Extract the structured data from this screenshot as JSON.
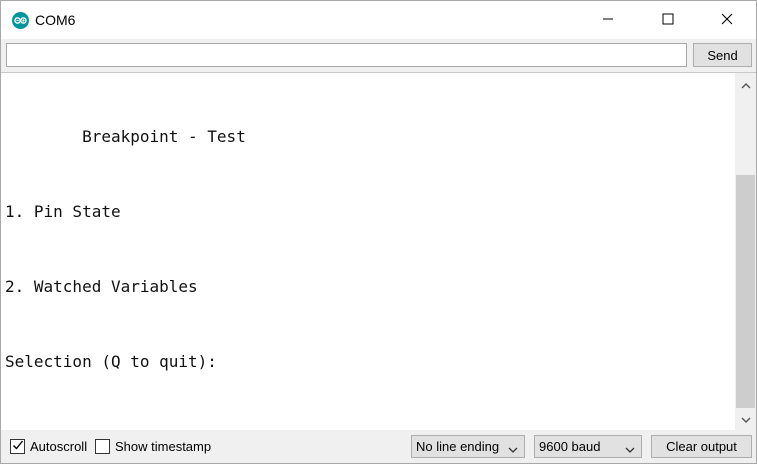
{
  "window": {
    "title": "COM6",
    "icon": "arduino-icon",
    "controls": [
      "minimize-icon",
      "maximize-icon",
      "close-icon"
    ]
  },
  "input": {
    "value": "",
    "placeholder": "",
    "send_label": "Send"
  },
  "output": {
    "lines": [
      "        Breakpoint - Test",
      "1. Pin State",
      "2. Watched Variables",
      "Selection (Q to quit):"
    ]
  },
  "bottombar": {
    "autoscroll_label": "Autoscroll",
    "autoscroll_checked": true,
    "timestamp_label": "Show timestamp",
    "timestamp_checked": false,
    "line_ending": "No line ending",
    "baud": "9600 baud",
    "clear_label": "Clear output"
  },
  "colors": {
    "arduino_teal": "#00979c",
    "button_face": "#e1e1e1",
    "window_bg": "#f0f0f0"
  }
}
